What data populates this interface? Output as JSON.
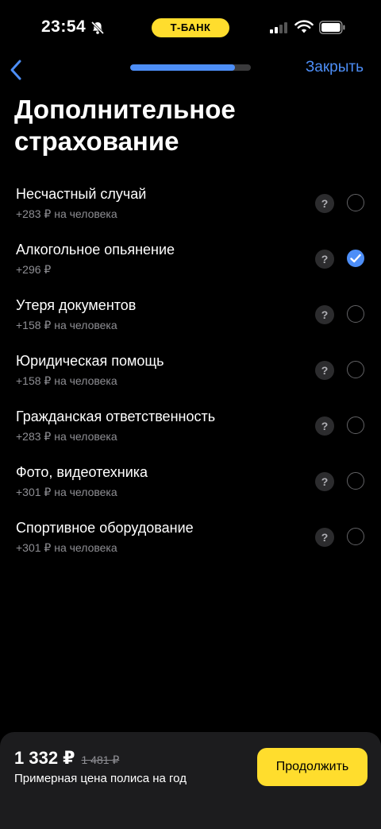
{
  "status_bar": {
    "time": "23:54",
    "bank_label": "Т-БАНК",
    "icons": [
      "bell-off-icon",
      "signal-icon",
      "wifi-icon",
      "battery-icon"
    ]
  },
  "nav": {
    "back_icon": "chevron-left-icon",
    "progress_fraction": 0.87,
    "close_label": "Закрыть"
  },
  "page": {
    "title": "Дополнительное страхование"
  },
  "options": [
    {
      "name": "Несчастный случай",
      "price": "+283 ₽ на человека",
      "checked": false
    },
    {
      "name": "Алкогольное опьянение",
      "price": "+296 ₽",
      "checked": true
    },
    {
      "name": "Утеря документов",
      "price": "+158 ₽ на человека",
      "checked": false
    },
    {
      "name": "Юридическая помощь",
      "price": "+158 ₽ на человека",
      "checked": false
    },
    {
      "name": "Гражданская ответственность",
      "price": "+283 ₽ на человека",
      "checked": false
    },
    {
      "name": "Фото, видеотехника",
      "price": "+301 ₽ на человека",
      "checked": false
    },
    {
      "name": "Спортивное оборудование",
      "price": "+301 ₽ на человека",
      "checked": false
    }
  ],
  "help_glyph": "?",
  "bottom": {
    "price": "1 332 ₽",
    "old_price": "1 481 ₽",
    "caption": "Примерная цена полиса на год",
    "continue_label": "Продолжить"
  },
  "colors": {
    "accent": "#4d8ef7",
    "brand_yellow": "#ffdd2d",
    "background": "#000000",
    "secondary_text": "#8e8e93"
  }
}
